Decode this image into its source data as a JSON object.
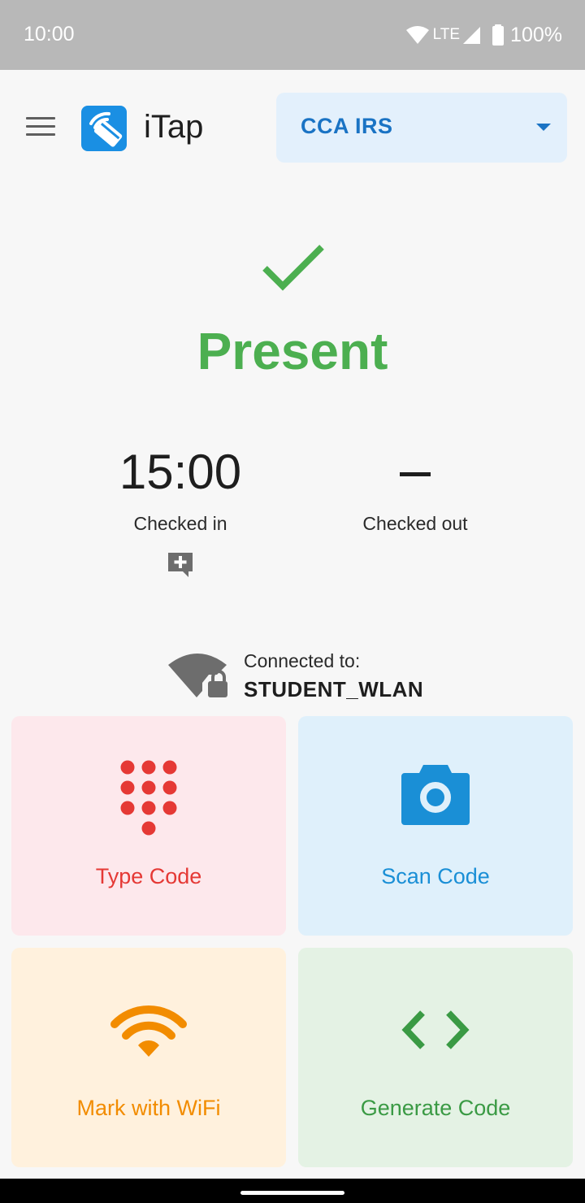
{
  "status_bar": {
    "time": "10:00",
    "network": "LTE",
    "battery": "100%",
    "icons": [
      "wifi-signal-icon",
      "cell-signal-icon",
      "battery-icon"
    ]
  },
  "app_bar": {
    "title": "iTap",
    "menu_icon": "hamburger-menu-icon",
    "logo_icon": "itap-logo-icon",
    "course_selector": {
      "selected": "CCA IRS",
      "icon": "dropdown-arrow-icon"
    }
  },
  "attendance": {
    "status": "Present",
    "status_icon": "checkmark-icon",
    "checked_in": {
      "time": "15:00",
      "label": "Checked in"
    },
    "checked_out": {
      "time": "",
      "label": "Checked out"
    },
    "add_comment_icon": "add-comment-icon"
  },
  "connection": {
    "label": "Connected to:",
    "ssid": "STUDENT_WLAN",
    "icon": "wifi-lock-icon"
  },
  "actions": [
    {
      "label": "Type Code",
      "icon": "keypad-icon",
      "color": "#e53935",
      "bg": "#fde8ec"
    },
    {
      "label": "Scan Code",
      "icon": "camera-icon",
      "color": "#1a8fd6",
      "bg": "#dff0fb"
    },
    {
      "label": "Mark with WiFi",
      "icon": "wifi-icon",
      "color": "#f28c00",
      "bg": "#fff1dd"
    },
    {
      "label": "Generate Code",
      "icon": "code-brackets-icon",
      "color": "#3a9a44",
      "bg": "#e4f2e4"
    }
  ],
  "colors": {
    "accent": "#1a73c4",
    "present": "#4caf50",
    "status_bar": "#b8b8b8"
  }
}
